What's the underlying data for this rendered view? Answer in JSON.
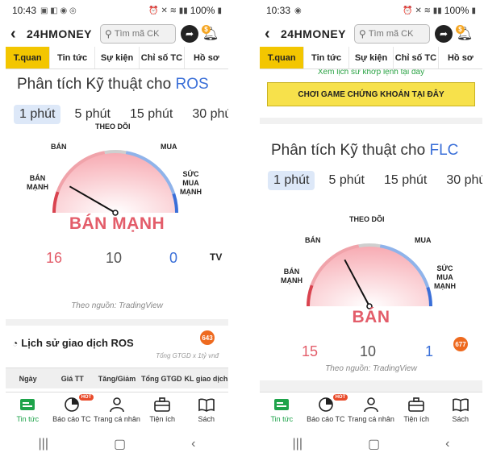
{
  "left": {
    "status": {
      "time": "10:43",
      "battery": "100%"
    },
    "header": {
      "brand": "24HMONEY",
      "search_placeholder": "Tìm mã CK"
    },
    "tabs": [
      "T.quan",
      "Tin tức",
      "Sự kiện",
      "Chỉ số TC",
      "Hồ sơ"
    ],
    "ta": {
      "title": "Phân tích Kỹ thuật cho",
      "symbol": "ROS",
      "timeframes": [
        "1 phút",
        "5 phút",
        "15 phút",
        "30 phút"
      ],
      "labels": {
        "strong_sell": "BÁN\nMẠNH",
        "sell": "BÁN",
        "neutral": "THEO DÕI",
        "buy": "MUA",
        "strong_buy": "SỨC\nMUA\nMẠNH"
      },
      "verdict": "BÁN MẠNH",
      "counts": {
        "sell": "16",
        "neutral": "10",
        "buy": "0"
      },
      "source": "Theo nguồn: TradingView"
    },
    "history": {
      "title": "Lịch sử giao dịch ROS",
      "badge": "643",
      "subtitle": "Tổng GTGD x 1tỷ vnđ",
      "columns": [
        "Ngày",
        "Giá TT",
        "Tăng/Giảm",
        "Tổng GTGD",
        "KL giao dịch"
      ]
    },
    "nav": [
      "Tin tức",
      "Báo cáo TC",
      "Trang cá nhân",
      "Tiện ích",
      "Sách"
    ],
    "hot": "HOT"
  },
  "right": {
    "status": {
      "time": "10:33",
      "battery": "100%"
    },
    "header": {
      "brand": "24HMONEY",
      "search_placeholder": "Tìm mã CK"
    },
    "tabs": [
      "T.quan",
      "Tin tức",
      "Sự kiện",
      "Chỉ số TC",
      "Hồ sơ"
    ],
    "promo": {
      "link": "Xem lịch sử khớp lệnh tại đây",
      "button": "CHƠI GAME CHỨNG KHOÁN TẠI ĐÂY"
    },
    "ta": {
      "title": "Phân tích Kỹ thuật cho",
      "symbol": "FLC",
      "timeframes": [
        "1 phút",
        "5 phút",
        "15 phút",
        "30 phút"
      ],
      "labels": {
        "strong_sell": "BÁN\nMẠNH",
        "sell": "BÁN",
        "neutral": "THEO DÕI",
        "buy": "MUA",
        "strong_buy": "SỨC\nMUA\nMẠNH"
      },
      "verdict": "BÁN",
      "counts": {
        "sell": "15",
        "neutral": "10",
        "buy": "1"
      },
      "badge": "677",
      "source": "Theo nguồn: TradingView"
    },
    "nav": [
      "Tin tức",
      "Báo cáo TC",
      "Trang cá nhân",
      "Tiện ích",
      "Sách"
    ],
    "hot": "HOT"
  },
  "gauges": {
    "left": {
      "needle_angle_deg": 150
    },
    "right": {
      "needle_angle_deg": 118
    }
  },
  "colors": {
    "accent_yellow": "#f3c600",
    "sell_red": "#e35d6a",
    "buy_blue": "#3a6fd8",
    "nav_green": "#1ea34a",
    "badge_orange": "#ee6a1f"
  },
  "icons": [
    "search-icon",
    "share-icon",
    "bell-icon",
    "clock-icon",
    "tradingview-icon",
    "news-icon",
    "report-icon",
    "profile-icon",
    "utilities-icon",
    "book-icon"
  ]
}
